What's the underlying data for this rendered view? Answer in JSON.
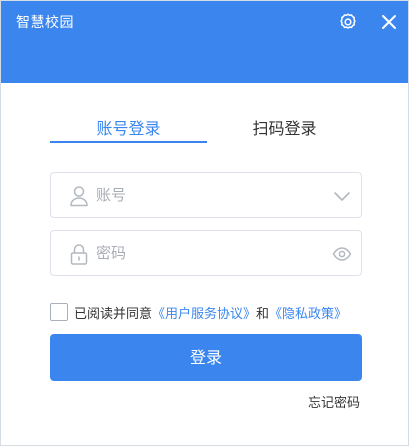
{
  "window": {
    "title": "智慧校园",
    "settings_icon": "gear-icon",
    "close_icon": "close-icon"
  },
  "tabs": [
    {
      "label": "账号登录",
      "active": true
    },
    {
      "label": "扫码登录",
      "active": false
    }
  ],
  "account_field": {
    "placeholder": "账号",
    "value": "",
    "icon": "user-icon",
    "trailing_icon": "chevron-down-icon"
  },
  "password_field": {
    "placeholder": "密码",
    "value": "",
    "icon": "lock-icon",
    "trailing_icon": "eye-icon"
  },
  "agreement": {
    "checked": false,
    "prefix": "已阅读并同意",
    "user_agreement": "《用户服务协议》",
    "and": "和",
    "privacy_policy": "《隐私政策》"
  },
  "login_button": "登录",
  "forgot_password": "忘记密码",
  "colors": {
    "accent": "#3a86ee",
    "text": "#333333",
    "placeholder": "#a8adb5",
    "border": "#dde2ea"
  }
}
